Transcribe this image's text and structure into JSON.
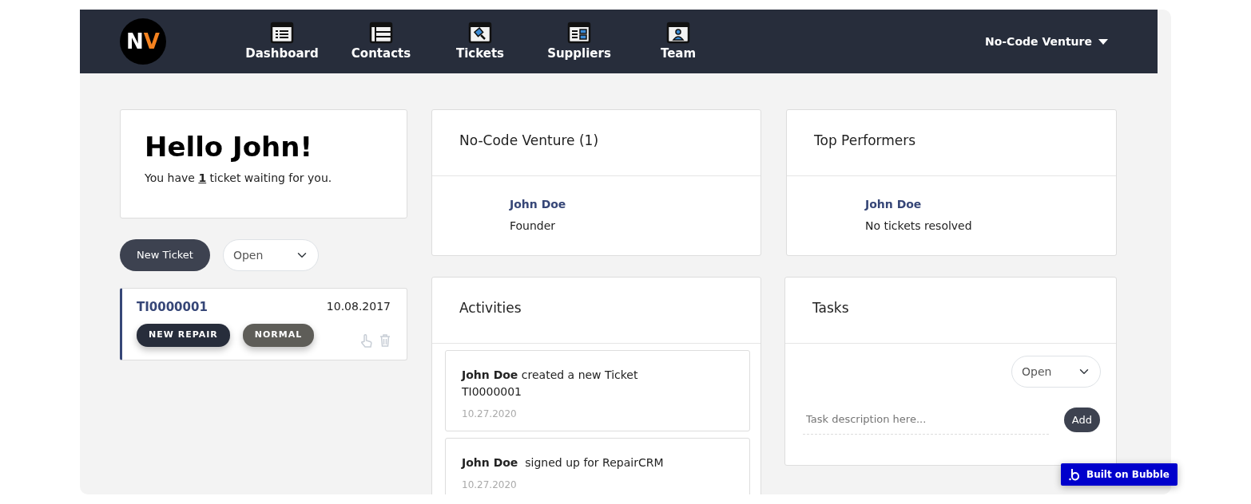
{
  "logo": {
    "parts": [
      {
        "text": "N",
        "color": "#ffffff"
      },
      {
        "text": "V",
        "color": "#f5821f"
      }
    ]
  },
  "nav": [
    {
      "label": "Dashboard",
      "kind": "dashboard"
    },
    {
      "label": "Contacts",
      "kind": "contacts"
    },
    {
      "label": "Tickets",
      "kind": "tickets"
    },
    {
      "label": "Suppliers",
      "kind": "suppliers"
    },
    {
      "label": "Team",
      "kind": "team"
    }
  ],
  "account": {
    "label": "No-Code Venture"
  },
  "greeting": {
    "title": "Hello John!",
    "message": "You have **1** ticket waiting for you."
  },
  "ticket_actions": {
    "button": "New Ticket",
    "filter": "Open"
  },
  "tickets": [
    {
      "id": "TI0000001",
      "date": "10.08.2017",
      "tags": [
        {
          "label": "NEW REPAIR",
          "color": "#272d3b"
        },
        {
          "label": "NORMAL",
          "color": "#5e5d58"
        }
      ]
    }
  ],
  "company": {
    "title": "No-Code Venture (1)",
    "members": [
      {
        "name": "John Doe",
        "role": "Founder"
      }
    ]
  },
  "top_performers": {
    "title": "Top Performers",
    "people": [
      {
        "name": "John Doe",
        "note": "No tickets resolved"
      }
    ]
  },
  "activities": {
    "title": "Activities",
    "items": [
      {
        "text": "**John Doe** created a new Ticket TI0000001",
        "date": "10.27.2020"
      },
      {
        "text": "**John Doe**  signed up for RepairCRM",
        "date": "10.27.2020"
      }
    ]
  },
  "tasks": {
    "title": "Tasks",
    "filter": "Open",
    "placeholder": "Task description here...",
    "button": "Add"
  },
  "badge": {
    "label": "Built on Bubble"
  }
}
